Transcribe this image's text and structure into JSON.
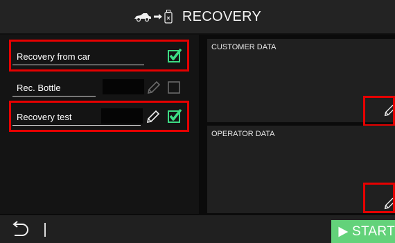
{
  "header": {
    "title": "RECOVERY",
    "icons": [
      "car-icon",
      "arrow-icon",
      "bottle-icon"
    ]
  },
  "left_panel": {
    "rows": [
      {
        "label": "Recovery from car",
        "checked": true,
        "editable": false,
        "highlighted": true
      },
      {
        "label": "Rec. Bottle",
        "checked": false,
        "editable": true,
        "highlighted": false
      },
      {
        "label": "Recovery test",
        "checked": true,
        "editable": true,
        "highlighted": true
      }
    ]
  },
  "customer_panel": {
    "title": "CUSTOMER DATA"
  },
  "operator_panel": {
    "title": "OPERATOR DATA"
  },
  "footer": {
    "start_label": "START"
  },
  "colors": {
    "accent_green": "#63d27a",
    "check_green": "#3ddc84",
    "highlight_red": "#e60000"
  }
}
